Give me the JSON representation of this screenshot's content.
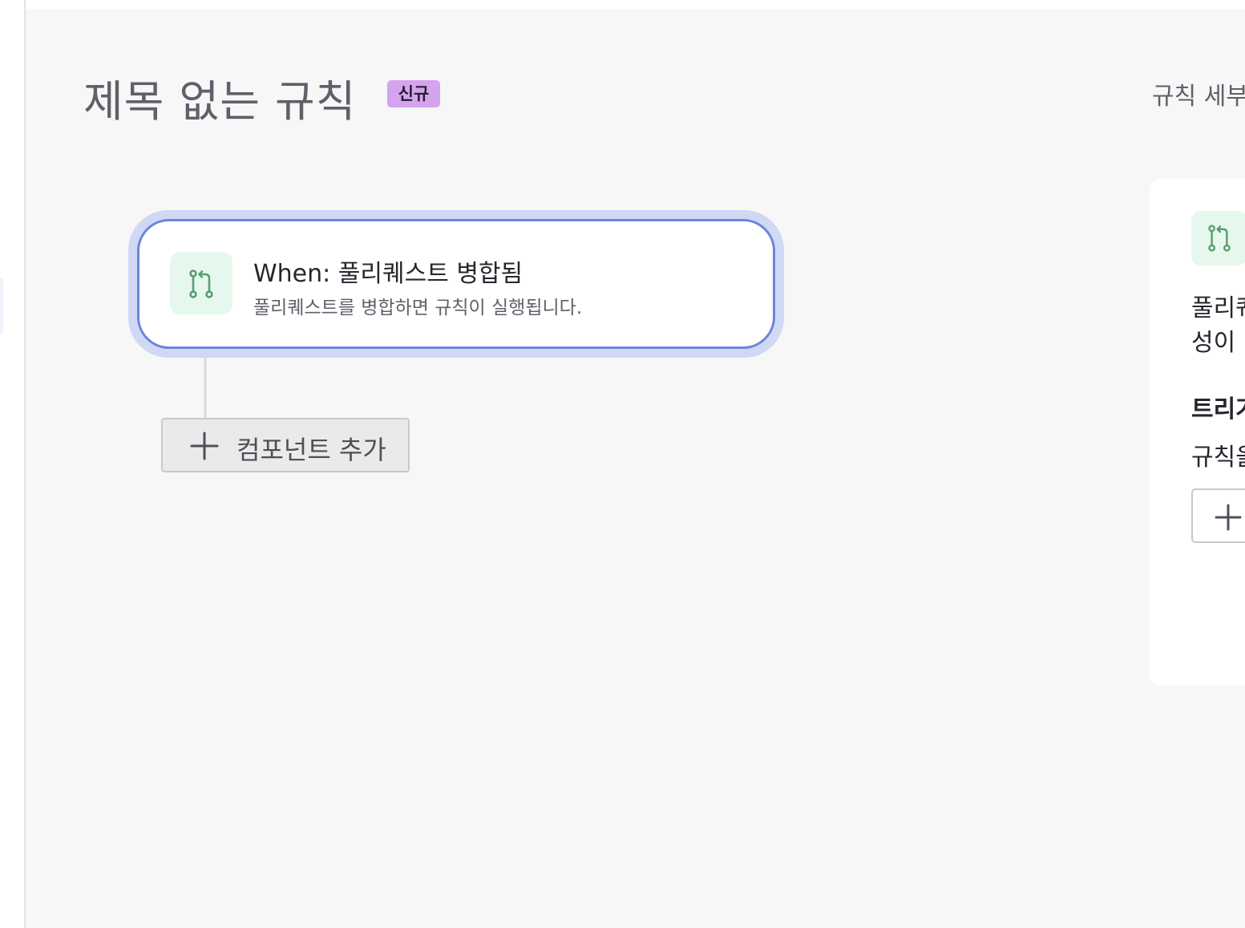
{
  "rule": {
    "title": "제목 없는 규칙",
    "badge": "신규"
  },
  "tabs": {
    "details_label": "규칙 세부"
  },
  "trigger": {
    "icon": "pull-request-icon",
    "heading": "When: 풀리퀘스트 병합됨",
    "description": "풀리퀘스트를 병합하면 규칙이 실행됩니다."
  },
  "add_component": {
    "icon": "plus-icon",
    "label": "컴포넌트 추가"
  },
  "side_panel": {
    "icon": "pull-request-icon",
    "description": "풀리퀘\n성이",
    "section_title": "트리거",
    "section_text": "규칙을",
    "add_icon": "plus-icon"
  },
  "colors": {
    "canvas_bg": "#f7f7f7",
    "badge_bg": "#d6a3ef",
    "trigger_border": "#6a86d8",
    "trigger_halo": "#cfd9f6",
    "icon_bg": "#e6f8ee",
    "icon_stroke": "#5a9e72"
  }
}
